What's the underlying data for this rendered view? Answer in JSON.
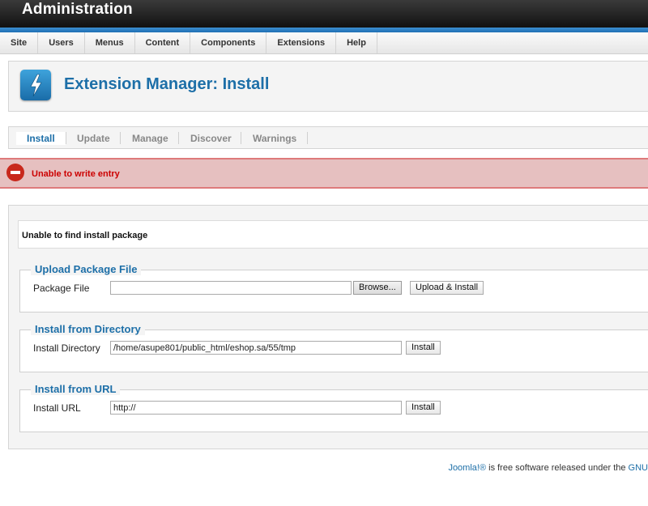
{
  "header": {
    "title": "Administration"
  },
  "menu": {
    "items": [
      "Site",
      "Users",
      "Menus",
      "Content",
      "Components",
      "Extensions",
      "Help"
    ]
  },
  "toolbar": {
    "title": "Extension Manager: Install",
    "icon": "extension-lightning-icon"
  },
  "submenu": {
    "tabs": [
      "Install",
      "Update",
      "Manage",
      "Discover",
      "Warnings"
    ],
    "active": "Install"
  },
  "error": {
    "message": "Unable to write entry",
    "icon": "error-stop-icon",
    "color": "#c8281c"
  },
  "notice": {
    "message": "Unable to find install package"
  },
  "upload": {
    "legend": "Upload Package File",
    "label": "Package File",
    "value": "",
    "browse_label": "Browse...",
    "button_label": "Upload & Install"
  },
  "directory": {
    "legend": "Install from Directory",
    "label": "Install Directory",
    "value": "/home/asupe801/public_html/eshop.sa/55/tmp",
    "button_label": "Install"
  },
  "url": {
    "legend": "Install from URL",
    "label": "Install URL",
    "value": "http://",
    "button_label": "Install"
  },
  "footer": {
    "brand": "Joomla!®",
    "text": " is free software released under the ",
    "license": "GNU"
  },
  "colors": {
    "accent": "#1d6fa8",
    "header": "#111111",
    "stripe": "#2a7fc3",
    "error_bg": "#e6c0c0"
  }
}
